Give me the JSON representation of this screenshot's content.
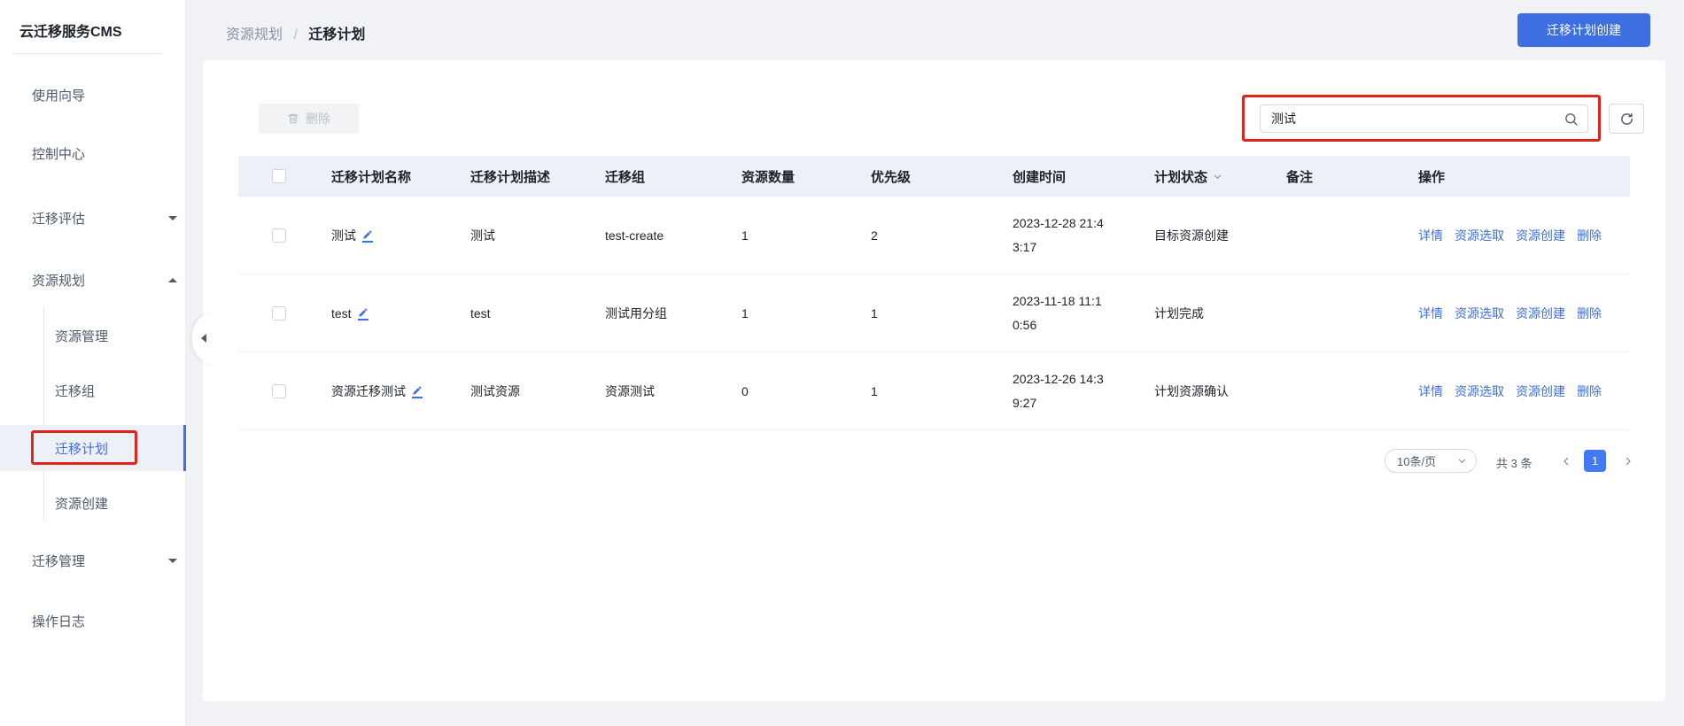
{
  "app": {
    "title": "云迁移服务CMS"
  },
  "sidebar": {
    "items": [
      {
        "label": "使用向导"
      },
      {
        "label": "控制中心"
      },
      {
        "label": "迁移评估",
        "arrow": "down"
      },
      {
        "label": "资源规划",
        "arrow": "up"
      },
      {
        "label": "迁移管理",
        "arrow": "down"
      },
      {
        "label": "操作日志"
      }
    ],
    "submenu": [
      {
        "label": "资源管理"
      },
      {
        "label": "迁移组"
      },
      {
        "label": "迁移计划",
        "selected": true
      },
      {
        "label": "资源创建"
      }
    ]
  },
  "breadcrumb": {
    "parent": "资源规划",
    "separator": "/",
    "current": "迁移计划"
  },
  "header": {
    "create_button": "迁移计划创建"
  },
  "toolbar": {
    "delete_button": "删除",
    "search_value": "测试"
  },
  "table": {
    "columns": [
      "迁移计划名称",
      "迁移计划描述",
      "迁移组",
      "资源数量",
      "优先级",
      "创建时间",
      "计划状态",
      "备注",
      "操作"
    ],
    "rows": [
      {
        "name": "测试",
        "desc": "测试",
        "group": "test-create",
        "count": "1",
        "priority": "2",
        "created_line1": "2023-12-28 21:4",
        "created_line2": "3:17",
        "status": "目标资源创建",
        "remark": ""
      },
      {
        "name": "test",
        "desc": "test",
        "group": "测试用分组",
        "count": "1",
        "priority": "1",
        "created_line1": "2023-11-18 11:1",
        "created_line2": "0:56",
        "status": "计划完成",
        "remark": ""
      },
      {
        "name": "资源迁移测试",
        "desc": "测试资源",
        "group": "资源测试",
        "count": "0",
        "priority": "1",
        "created_line1": "2023-12-26 14:3",
        "created_line2": "9:27",
        "status": "计划资源确认",
        "remark": ""
      }
    ],
    "ops": [
      "详情",
      "资源选取",
      "资源创建",
      "删除"
    ]
  },
  "pagination": {
    "page_size": "10条/页",
    "total": "共 3 条",
    "current_page": "1"
  },
  "colors": {
    "primary": "#3D6FE2",
    "annotation_red": "#E0261C",
    "header_bg": "#EDF0F9",
    "page_bg": "#F0F2F5"
  }
}
